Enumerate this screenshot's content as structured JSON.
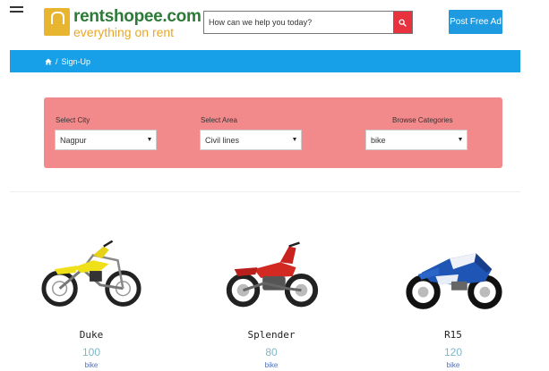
{
  "header": {
    "menu_icon": "hamburger-menu-icon",
    "logo": {
      "name": "rentshopee.com",
      "tagline": "everything on rent"
    },
    "search": {
      "placeholder": "How can we help you today?",
      "value": "",
      "icon": "search-icon",
      "button_color": "#e8323d"
    },
    "post_ad_label": "Post Free Ad"
  },
  "breadcrumb": {
    "home_icon": "home-icon",
    "separator": "/",
    "current": "Sign-Up"
  },
  "filters": {
    "city": {
      "label": "Select City",
      "value": "Nagpur"
    },
    "area": {
      "label": "Select Area",
      "value": "Civil lines"
    },
    "category": {
      "label": "Browse Categories",
      "value": "bike"
    }
  },
  "products": [
    {
      "name": "Duke",
      "price": "100",
      "category": "bike",
      "image": "dirt-bike-image"
    },
    {
      "name": "Splender",
      "price": "80",
      "category": "bike",
      "image": "red-motorcycle-image"
    },
    {
      "name": "R15",
      "price": "120",
      "category": "bike",
      "image": "sport-bike-image"
    }
  ],
  "colors": {
    "brand_green": "#2d7a38",
    "brand_orange": "#e8a72a",
    "accent_blue": "#17a0e8",
    "filter_panel": "#f2898b",
    "price": "#7fb8c8",
    "category": "#4a6fc0"
  }
}
